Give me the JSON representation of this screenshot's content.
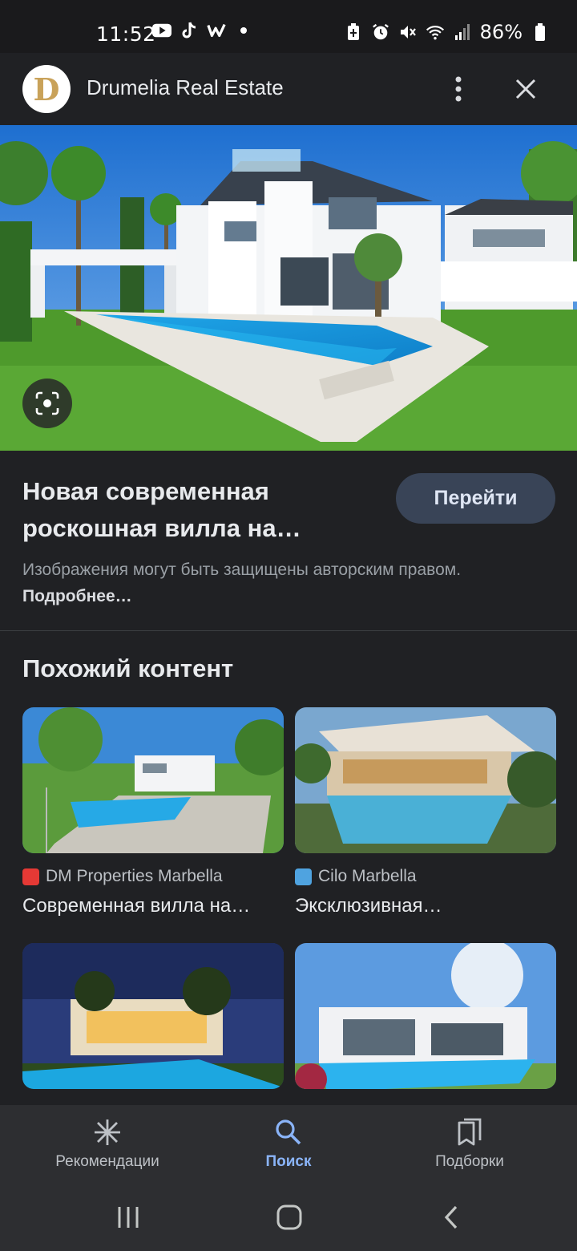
{
  "status_bar": {
    "time": "11:52",
    "battery": "86%",
    "left_icons": [
      "youtube-icon",
      "tiktok-icon",
      "w-app-icon",
      "dot-icon"
    ],
    "right_icons": [
      "battery-saver-icon",
      "alarm-icon",
      "mute-icon",
      "wifi-icon",
      "signal-icon",
      "battery-icon"
    ]
  },
  "header": {
    "logo_letter": "D",
    "site_name": "Drumelia Real Estate"
  },
  "result": {
    "title": "Новая современная роскошная вилла на…",
    "visit_button": "Перейти",
    "copyright_text": "Изображения могут быть защищены авторским правом. ",
    "copyright_link": "Подробнее…"
  },
  "similar": {
    "heading": "Похожий контент",
    "items": [
      {
        "source": "DM Properties Marbella",
        "title": "Современная вилла на…",
        "favicon_color": "#e53935"
      },
      {
        "source": "Cilo Marbella",
        "title": "Эксклюзивная…",
        "favicon_color": "#4fa3e0"
      },
      {
        "source": "",
        "title": ""
      },
      {
        "source": "",
        "title": ""
      }
    ]
  },
  "bottom_nav": {
    "items": [
      {
        "label": "Рекомендации",
        "icon": "asterisk-icon"
      },
      {
        "label": "Поиск",
        "icon": "search-icon",
        "active": true
      },
      {
        "label": "Подборки",
        "icon": "collections-icon"
      }
    ]
  },
  "system_nav": [
    "recents-icon",
    "home-icon",
    "back-icon"
  ],
  "colors": {
    "accent": "#8ab4f8",
    "button_bg": "#394457",
    "background": "#202124"
  }
}
